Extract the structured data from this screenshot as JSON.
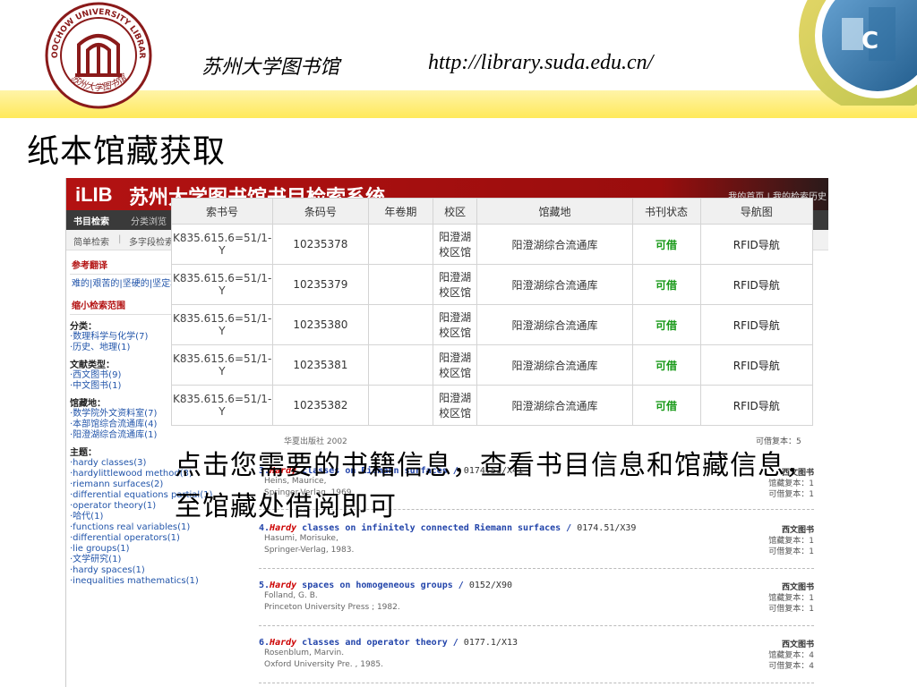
{
  "slide": {
    "site_title": "苏州大学图书馆",
    "site_url": "http://library.suda.edu.cn/",
    "heading": "纸本馆藏获取",
    "annotation": "点击您需要的书籍信息，查看书目信息和馆藏信息，至馆藏处借阅即可"
  },
  "logo": {
    "ring_text_top": "SOOCHOW UNIVERSITY LIBRARY",
    "ring_text_bottom": "苏州大学图书馆"
  },
  "colors": {
    "brand_red": "#b31212",
    "band_yellow": "#ffe95a",
    "status_green": "#1a9a1a"
  },
  "opac": {
    "logo": "iLIB",
    "system_name": "苏州大学图书馆书目检索系统",
    "header_links": "我的首页 | 我的检索历史",
    "nav": [
      "书目检索",
      "分类浏览"
    ],
    "subnav": [
      "简单检索",
      "多字段检索"
    ],
    "sidebar": {
      "ref_title": "参考翻译",
      "ref_text": "难的|艰苦的|坚硬的|坚定地|坚硬地",
      "narrow_title": "缩小检索范围",
      "category_label": "分类：",
      "categories": [
        "·数理科学与化学(7)",
        "·历史、地理(1)"
      ],
      "doctype_label": "文献类型：",
      "doctypes": [
        "·西文图书(9)",
        "·中文图书(1)"
      ],
      "location_label": "馆藏地：",
      "locations": [
        "·数学院外文资料室(7)",
        "·本部馆综合流通库(4)",
        "·阳澄湖综合流通库(1)"
      ],
      "subject_label": "主题：",
      "subjects": [
        "·hardy classes(3)",
        "·hardylittlewood method(3)",
        "·riemann surfaces(2)",
        "·differential equations partial(1)",
        "·operator theory(1)",
        "·哈代(1)",
        "·functions real variables(1)",
        "·differential operators(1)",
        "·lie groups(1)",
        "·文学研究(1)",
        "·hardy spaces(1)",
        "·inequalities mathematics(1)"
      ]
    },
    "prev_publisher": "华夏出版社 2002",
    "prev_copies": "可借复本：5",
    "results": [
      {
        "num": "3.",
        "hl": "Hardy",
        "rest": " classes on Riemann surfaces /",
        "call": " 0174.51/X41",
        "author": "Heins, Maurice,",
        "publisher": "Springer-Verlag, 1969.",
        "type": "西文图书",
        "holdings": "馆藏复本：1",
        "available": "可借复本：1"
      },
      {
        "num": "4.",
        "hl": "Hardy",
        "rest": " classes on infinitely connected Riemann surfaces /",
        "call": " 0174.51/X39",
        "author": "Hasumi, Morisuke,",
        "publisher": "Springer-Verlag, 1983.",
        "type": "西文图书",
        "holdings": "馆藏复本：1",
        "available": "可借复本：1"
      },
      {
        "num": "5.",
        "hl": "Hardy",
        "rest": " spaces on homogeneous groups /",
        "call": " 0152/X90",
        "author": "Folland, G. B.",
        "publisher": "Princeton University Press ; 1982.",
        "type": "西文图书",
        "holdings": "馆藏复本：1",
        "available": "可借复本：1"
      },
      {
        "num": "6.",
        "hl": "Hardy",
        "rest": " classes and operator theory /",
        "call": " 0177.1/X13",
        "author": "Rosenblum, Marvin.",
        "publisher": "Oxford University Pre. , 1985.",
        "type": "西文图书",
        "holdings": "馆藏复本：4",
        "available": "可借复本：4"
      }
    ]
  },
  "holdings_table": {
    "headers": [
      "索书号",
      "条码号",
      "年卷期",
      "校区",
      "馆藏地",
      "书刊状态",
      "导航图"
    ],
    "rows": [
      [
        "K835.615.6=51/1-Y",
        "10235378",
        "",
        "阳澄湖校区馆",
        "阳澄湖综合流通库",
        "可借",
        "RFID导航"
      ],
      [
        "K835.615.6=51/1-Y",
        "10235379",
        "",
        "阳澄湖校区馆",
        "阳澄湖综合流通库",
        "可借",
        "RFID导航"
      ],
      [
        "K835.615.6=51/1-Y",
        "10235380",
        "",
        "阳澄湖校区馆",
        "阳澄湖综合流通库",
        "可借",
        "RFID导航"
      ],
      [
        "K835.615.6=51/1-Y",
        "10235381",
        "",
        "阳澄湖校区馆",
        "阳澄湖综合流通库",
        "可借",
        "RFID导航"
      ],
      [
        "K835.615.6=51/1-Y",
        "10235382",
        "",
        "阳澄湖校区馆",
        "阳澄湖综合流通库",
        "可借",
        "RFID导航"
      ]
    ]
  }
}
